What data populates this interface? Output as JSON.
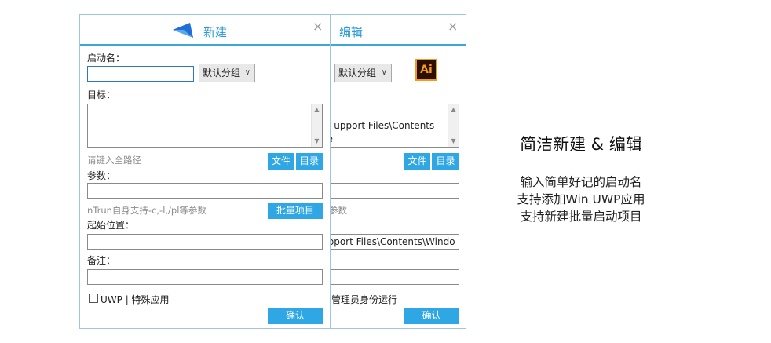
{
  "back_dialog": {
    "title": "编辑",
    "close": "×",
    "group_select": "默认分组",
    "target_text": "upport Files\\Contents\nke",
    "file_button": "文件",
    "dir_button": "目录",
    "params_value": "",
    "params_hint_tail": "参数",
    "start_location_value": "upport Files\\Contents\\Windo",
    "note_value": "",
    "admin_label": "以管理员身份运行",
    "confirm_button": "确认",
    "app_icon_text": "Ai"
  },
  "front_dialog": {
    "title": "新建",
    "close": "×",
    "name_label": "启动名：",
    "name_value": "",
    "group_select": "默认分组",
    "target_label": "目标：",
    "target_value": "",
    "target_hint": "请键入全路径",
    "file_button": "文件",
    "dir_button": "目录",
    "params_label": "参数：",
    "params_value": "",
    "params_hint": "nTrun自身支持-c,-l,/pl等参数",
    "batch_button": "批量项目",
    "start_location_label": "起始位置：",
    "start_location_value": "",
    "note_label": "备注：",
    "note_value": "",
    "uwp_label": "UWP | 特殊应用",
    "confirm_button": "确认"
  },
  "promo": {
    "title": "简洁新建 & 编辑",
    "lines": [
      "输入简单好记的启动名",
      "支持添加Win UWP应用",
      "支持新建批量启动项目"
    ]
  },
  "colors": {
    "accent": "#2fa7e4",
    "title_text": "#2a9ad6",
    "logo": "#1f6fd6",
    "ai_bg": "#2b0f00",
    "ai_fg": "#f39a1d"
  }
}
